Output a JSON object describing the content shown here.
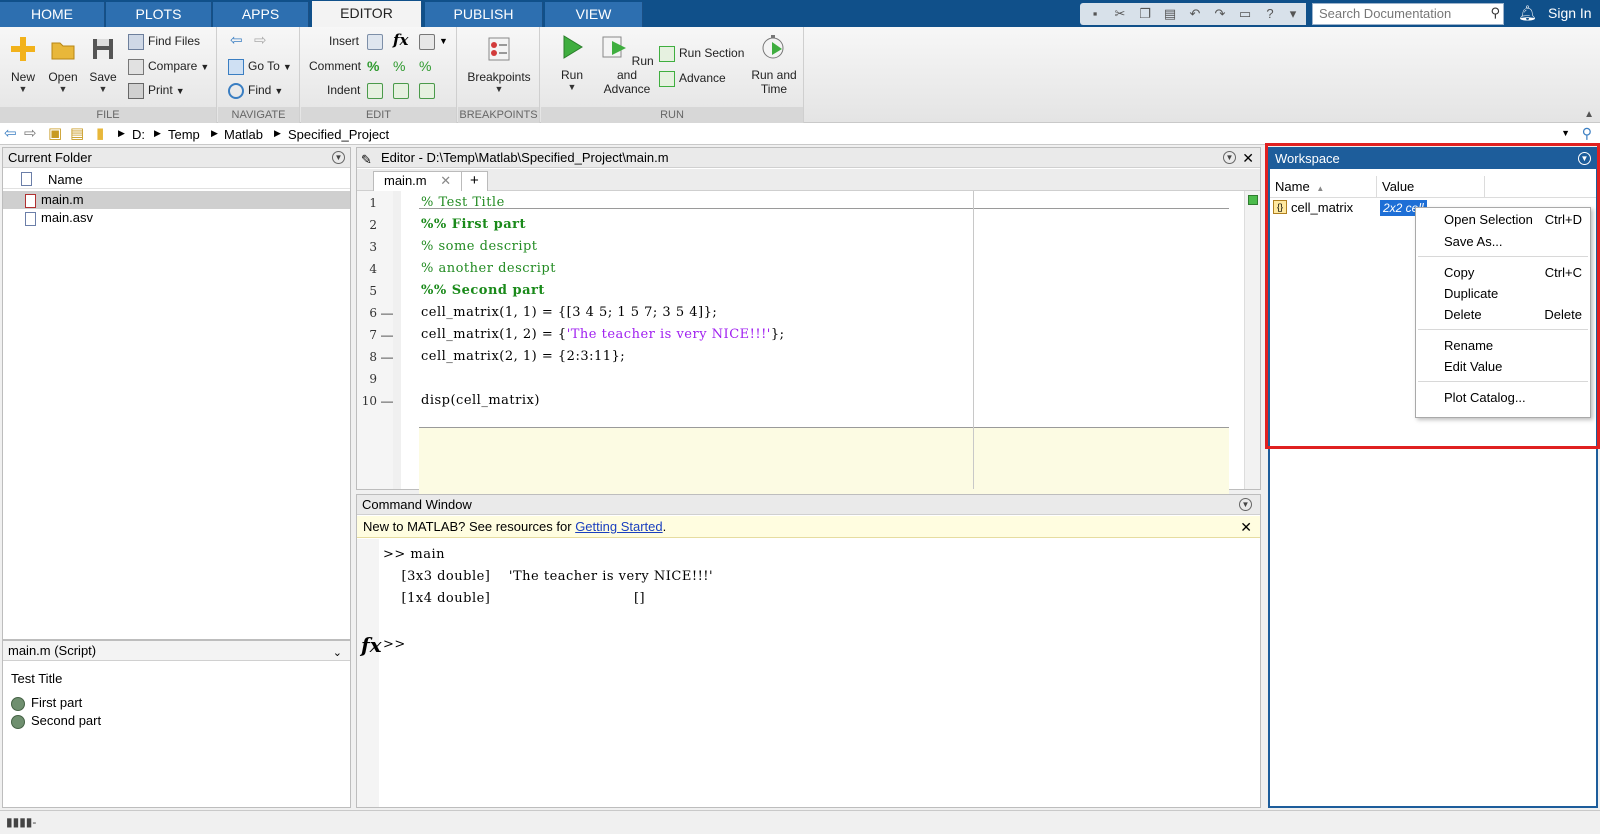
{
  "tabs": [
    {
      "label": "HOME",
      "active": false
    },
    {
      "label": "PLOTS",
      "active": false
    },
    {
      "label": "APPS",
      "active": false
    },
    {
      "label": "EDITOR",
      "active": true
    },
    {
      "label": "PUBLISH",
      "active": false
    },
    {
      "label": "VIEW",
      "active": false
    }
  ],
  "search": {
    "placeholder": "Search Documentation"
  },
  "sign_in": "Sign In",
  "ribbon": {
    "file": {
      "label": "FILE",
      "new": "New",
      "open": "Open",
      "save": "Save",
      "find_files": "Find Files",
      "compare": "Compare",
      "print": "Print"
    },
    "navigate": {
      "label": "NAVIGATE",
      "go_to": "Go To",
      "find": "Find"
    },
    "edit": {
      "label": "EDIT",
      "insert": "Insert",
      "comment": "Comment",
      "indent": "Indent",
      "fx": "fx"
    },
    "breakpoints": {
      "label": "BREAKPOINTS",
      "breakpoints": "Breakpoints"
    },
    "run": {
      "label": "RUN",
      "run": "Run",
      "run_and": "Run and",
      "advance": "Advance",
      "run_section": "Run Section",
      "advance_small": "Advance",
      "run_and2": "Run and",
      "time": "Time"
    }
  },
  "address": {
    "crumbs": [
      "D:",
      "Temp",
      "Matlab",
      "Specified_Project"
    ]
  },
  "current_folder": {
    "title": "Current Folder",
    "col_name": "Name",
    "files": [
      {
        "name": "main.m",
        "selected": true
      },
      {
        "name": "main.asv",
        "selected": false
      }
    ]
  },
  "details": {
    "title": "main.m  (Script)",
    "heading": "Test Title",
    "items": [
      "First part",
      "Second part"
    ]
  },
  "editor": {
    "title": "Editor - D:\\Temp\\Matlab\\Specified_Project\\main.m",
    "tab": "main.m",
    "add_tab": "+",
    "lines": [
      {
        "n": "1",
        "dash": "",
        "text": "% Test Title",
        "kind": "comment"
      },
      {
        "n": "2",
        "dash": "",
        "text": "%% First part",
        "kind": "cell"
      },
      {
        "n": "3",
        "dash": "",
        "text": "% some descript",
        "kind": "comment"
      },
      {
        "n": "4",
        "dash": "",
        "text": "% another descript",
        "kind": "comment"
      },
      {
        "n": "5",
        "dash": "",
        "text": "%% Second part",
        "kind": "cell"
      },
      {
        "n": "6",
        "dash": "—",
        "text": "cell_matrix(1, 1) = {[3 4 5; 1 5 7; 3 5 4]};",
        "kind": "code"
      },
      {
        "n": "7",
        "dash": "—",
        "text_pre": "cell_matrix(1, 2) = {",
        "text_str": "'The teacher is very NICE!!!'",
        "text_post": "};",
        "kind": "mixed"
      },
      {
        "n": "8",
        "dash": "—",
        "text": "cell_matrix(2, 1) = {2:3:11};",
        "kind": "code"
      },
      {
        "n": "9",
        "dash": "",
        "text": "",
        "kind": "code"
      },
      {
        "n": "10",
        "dash": "—",
        "text": "disp(cell_matrix)",
        "kind": "code"
      }
    ]
  },
  "command_window": {
    "title": "Command Window",
    "banner_pre": "New to MATLAB? See resources for ",
    "banner_link": "Getting Started",
    "banner_post": ".",
    "lines": [
      ">> main",
      "    [3x3 double]    'The teacher is very NICE!!!'",
      "    [1x4 double]                               []"
    ],
    "prompt": ">>",
    "fx": "fx"
  },
  "workspace": {
    "title": "Workspace",
    "col_name": "Name",
    "col_value": "Value",
    "var_name": "cell_matrix",
    "var_value": "2x2 cell"
  },
  "context_menu": [
    {
      "label": "Open Selection",
      "shortcut": "Ctrl+D"
    },
    {
      "label": "Save As...",
      "shortcut": ""
    },
    {
      "label": "Copy",
      "shortcut": "Ctrl+C"
    },
    {
      "label": "Duplicate",
      "shortcut": ""
    },
    {
      "label": "Delete",
      "shortcut": "Delete"
    },
    {
      "label": "Rename",
      "shortcut": ""
    },
    {
      "label": "Edit Value",
      "shortcut": ""
    },
    {
      "label": "Plot Catalog...",
      "shortcut": ""
    }
  ],
  "colors": {
    "accent": "#10508a",
    "highlight": "#e02020",
    "cell_bg": "#fcfbe3"
  }
}
